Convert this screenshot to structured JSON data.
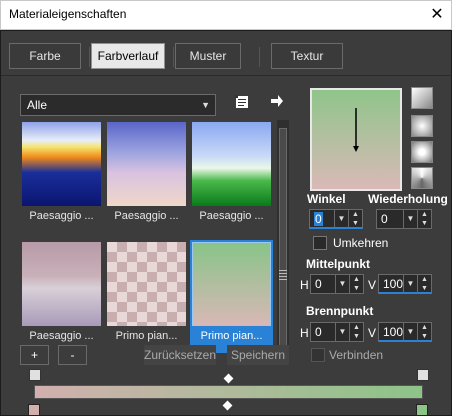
{
  "window": {
    "title": "Materialeigenschaften",
    "close_glyph": "✕"
  },
  "tabs": [
    {
      "label": "Farbe"
    },
    {
      "label": "Farbverlauf",
      "active": true
    },
    {
      "label": "Muster"
    },
    {
      "label": "Textur"
    }
  ],
  "library": {
    "category": "Alle",
    "thumbnails": [
      {
        "label": "Paesaggio ..."
      },
      {
        "label": "Paesaggio ..."
      },
      {
        "label": "Paesaggio ..."
      },
      {
        "label": "Paesaggio ..."
      },
      {
        "label": "Primo pian..."
      },
      {
        "label": "Primo pian...",
        "selected": true
      }
    ]
  },
  "angle": {
    "label": "Winkel",
    "value": "0"
  },
  "repeat": {
    "label": "Wiederholung",
    "value": "0"
  },
  "invert": {
    "label": "Umkehren"
  },
  "center": {
    "label": "Mittelpunkt",
    "h_label": "H",
    "h_value": "0",
    "v_label": "V",
    "v_value": "100"
  },
  "focus": {
    "label": "Brennpunkt",
    "h_label": "H",
    "h_value": "0",
    "v_label": "V",
    "v_value": "100"
  },
  "link": {
    "label": "Verbinden"
  },
  "buttons": {
    "add": "+",
    "remove": "-",
    "reset": "Zurücksetzen",
    "save": "Speichern"
  },
  "colors": {
    "accent": "#2a82d6",
    "gradient_start": "#d2b0ae",
    "gradient_end": "#8dc488"
  }
}
